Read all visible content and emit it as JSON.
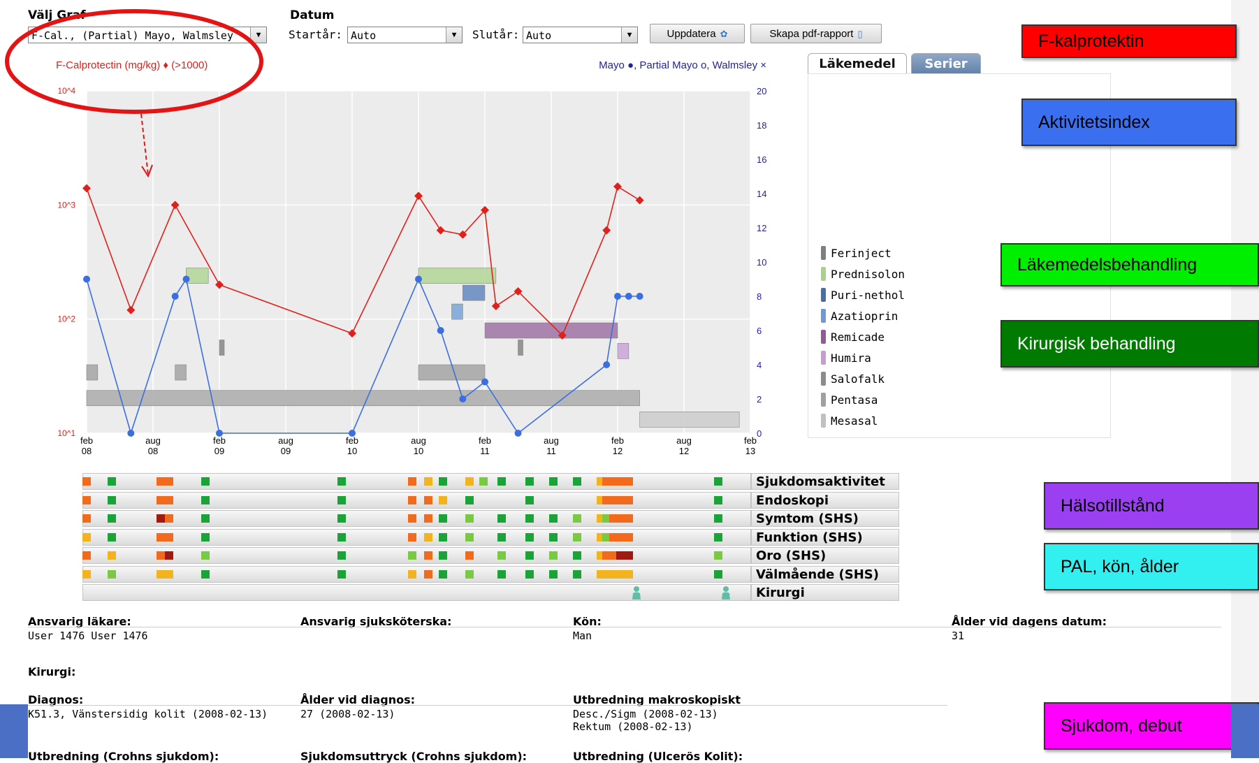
{
  "toolbar": {
    "valj_graf_label": "Välj Graf",
    "datum_label": "Datum",
    "graph_select_value": "F-Cal., (Partial) Mayo, Walmsley",
    "startar_label": "Startår:",
    "startar_value": "Auto",
    "slutar_label": "Slutår:",
    "slutar_value": "Auto",
    "update_button": "Uppdatera",
    "pdf_button": "Skapa pdf-rapport"
  },
  "tabs": [
    {
      "label": "Läkemedel",
      "active": true
    },
    {
      "label": "Serier",
      "active": false
    }
  ],
  "legend": {
    "items": [
      {
        "label": "Ferinject",
        "color": "#7f7f7f"
      },
      {
        "label": "Prednisolon",
        "color": "#a9d18e"
      },
      {
        "label": "Puri-nethol",
        "color": "#4a6fa5"
      },
      {
        "label": "Azatioprin",
        "color": "#6f9bd1"
      },
      {
        "label": "Remicade",
        "color": "#8e5b96"
      },
      {
        "label": "Humira",
        "color": "#c59ed0"
      },
      {
        "label": "Salofalk",
        "color": "#8c8c8c"
      },
      {
        "label": "Pentasa",
        "color": "#a0a0a0"
      },
      {
        "label": "Mesasal",
        "color": "#c0c0c0"
      }
    ]
  },
  "chart_data": {
    "type": "line",
    "left_title": "F-Calprotectin (mg/kg) ♦ (>1000)",
    "right_title": "Mayo ●, Partial Mayo o, Walmsley ×",
    "left_axis": {
      "scale": "log",
      "range": [
        10,
        10000
      ],
      "ticks": [
        "10^4",
        "10^3",
        "10^2",
        "10^1"
      ]
    },
    "right_axis": {
      "range": [
        0,
        20
      ],
      "ticks": [
        "20",
        "18",
        "16",
        "14",
        "12",
        "10",
        "8",
        "6",
        "4",
        "2",
        "0"
      ]
    },
    "x_ticks": [
      {
        "m": "feb",
        "y": "08"
      },
      {
        "m": "aug",
        "y": "08"
      },
      {
        "m": "feb",
        "y": "09"
      },
      {
        "m": "aug",
        "y": "09"
      },
      {
        "m": "feb",
        "y": "10"
      },
      {
        "m": "aug",
        "y": "10"
      },
      {
        "m": "feb",
        "y": "11"
      },
      {
        "m": "aug",
        "y": "11"
      },
      {
        "m": "feb",
        "y": "12"
      },
      {
        "m": "aug",
        "y": "12"
      },
      {
        "m": "feb",
        "y": "13"
      }
    ],
    "series": [
      {
        "name": "F-Calprotectin",
        "color": "#e0211b",
        "marker": "diamond",
        "axis": "left",
        "points": [
          [
            "2008-02",
            1400
          ],
          [
            "2008-06",
            120
          ],
          [
            "2008-10",
            1000
          ],
          [
            "2009-02",
            200
          ],
          [
            "2010-02",
            75
          ],
          [
            "2010-08",
            1200
          ],
          [
            "2010-10",
            600
          ],
          [
            "2010-12",
            550
          ],
          [
            "2011-02",
            900
          ],
          [
            "2011-03",
            130
          ],
          [
            "2011-05",
            175
          ],
          [
            "2011-09",
            72
          ],
          [
            "2012-01",
            600
          ],
          [
            "2012-02",
            1450
          ],
          [
            "2012-04",
            1100
          ]
        ]
      },
      {
        "name": "Mayo",
        "color": "#3b6fe0",
        "marker": "circle",
        "axis": "right",
        "points": [
          [
            "2008-02",
            9
          ],
          [
            "2008-06",
            0
          ],
          [
            "2008-10",
            8
          ],
          [
            "2008-11",
            9
          ],
          [
            "2009-02",
            0
          ],
          [
            "2010-02",
            0
          ],
          [
            "2010-08",
            9
          ],
          [
            "2010-10",
            6
          ],
          [
            "2010-12",
            2
          ],
          [
            "2011-02",
            3
          ],
          [
            "2011-05",
            0
          ],
          [
            "2012-01",
            4
          ],
          [
            "2012-02",
            8
          ],
          [
            "2012-03",
            8
          ],
          [
            "2012-04",
            8
          ]
        ]
      }
    ],
    "bars": [
      {
        "drug": "Ferinject",
        "start": "2009-02",
        "end": "2009-02",
        "color": "#8c8c8c"
      },
      {
        "drug": "Ferinject",
        "start": "2011-05",
        "end": "2011-05",
        "color": "#8c8c8c"
      },
      {
        "drug": "Prednisolon",
        "start": "2008-11",
        "end": "2009-01",
        "color": "#b6d99c"
      },
      {
        "drug": "Prednisolon",
        "start": "2010-08",
        "end": "2011-03",
        "color": "#b6d99c"
      },
      {
        "drug": "Puri-nethol",
        "start": "2010-12",
        "end": "2011-02",
        "color": "#6b8fc2"
      },
      {
        "drug": "Azatioprin",
        "start": "2010-11",
        "end": "2010-12",
        "color": "#7fa9dc"
      },
      {
        "drug": "Remicade",
        "start": "2011-02",
        "end": "2012-02",
        "color": "#a27aa9"
      },
      {
        "drug": "Humira",
        "start": "2012-02",
        "end": "2012-03",
        "color": "#cfa9db"
      },
      {
        "drug": "Salofalk",
        "start": "2008-02",
        "end": "2008-03",
        "color": "#a9a9a9"
      },
      {
        "drug": "Salofalk",
        "start": "2008-10",
        "end": "2008-11",
        "color": "#a9a9a9"
      },
      {
        "drug": "Salofalk",
        "start": "2010-08",
        "end": "2011-02",
        "color": "#a9a9a9"
      },
      {
        "drug": "Pentasa",
        "start": "2008-02",
        "end": "2012-04",
        "color": "#b0b0b0"
      },
      {
        "drug": "Mesasal",
        "start": "2012-04",
        "end": "2013-01",
        "color": "#cfcfcf"
      }
    ]
  },
  "heatmap": {
    "rows": [
      "Sjukdomsaktivitet",
      "Endoskopi",
      "Symtom (SHS)",
      "Funktion (SHS)",
      "Oro (SHS)",
      "Välmående (SHS)",
      "Kirurgi"
    ],
    "colors": {
      "g": "#1aa337",
      "lg": "#7ac943",
      "y": "#f2b31c",
      "o": "#f26a1b",
      "r": "#a11a12"
    }
  },
  "callouts": [
    {
      "text": "F-kalprotektin",
      "color": "#ff0000"
    },
    {
      "text": "Aktivitetsindex",
      "color": "#3a6ff0"
    },
    {
      "text": "Läkemedelsbehandling",
      "color": "#00ee00"
    },
    {
      "text": "Kirurgisk behandling",
      "color": "#007a00"
    },
    {
      "text": "Hälsotillstånd",
      "color": "#9b40f0"
    },
    {
      "text": "PAL, kön, ålder",
      "color": "#33f0f0"
    },
    {
      "text": "Sjukdom, debut",
      "color": "#ff00ff"
    }
  ],
  "info": {
    "ansvarig_lakare_label": "Ansvarig läkare:",
    "ansvarig_lakare_value": "User 1476 User 1476",
    "ansvarig_sjukskoterska_label": "Ansvarig sjuksköterska:",
    "kon_label": "Kön:",
    "kon_value": "Man",
    "alder_label": "Ålder vid dagens datum:",
    "alder_value": "31",
    "kirurgi_label": "Kirurgi:",
    "diagnos_label": "Diagnos:",
    "diagnos_value": "K51.3, Vänstersidig kolit (2008-02-13)",
    "alder_diagnos_label": "Ålder vid diagnos:",
    "alder_diagnos_value": "27 (2008-02-13)",
    "utbredning_label": "Utbredning makroskopiskt",
    "utbredning_value1": "Desc./Sigm (2008-02-13)",
    "utbredning_value2": "Rektum (2008-02-13)",
    "cut1": "Utbredning (Crohns sjukdom):",
    "cut2": "Sjukdomsuttryck (Crohns sjukdom):",
    "cut3": "Utbredning (Ulcerös Kolit):"
  }
}
